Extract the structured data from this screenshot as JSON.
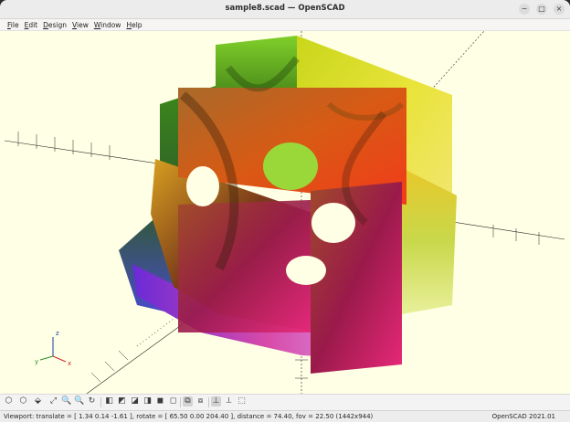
{
  "window": {
    "title": "sample8.scad — OpenSCAD"
  },
  "window_buttons": {
    "minimize": "−",
    "maximize": "□",
    "close": "×"
  },
  "menubar": [
    "File",
    "Edit",
    "Design",
    "View",
    "Window",
    "Help"
  ],
  "toolbar": {
    "icons": [
      "render-preview-icon",
      "render-icon",
      "export-stl-icon",
      "view-all-icon",
      "zoom-in-icon",
      "zoom-out-icon",
      "reset-view-icon",
      "view-right-icon",
      "view-top-icon",
      "view-bottom-icon",
      "view-left-icon",
      "view-front-icon",
      "view-back-icon",
      "perspective-icon",
      "orthogonal-icon",
      "show-axes-icon",
      "show-scale-markers-icon",
      "show-edges-icon"
    ],
    "glyphs": [
      "⬡",
      "⬡",
      "⬙",
      "⤢",
      "🔍",
      "🔍",
      "↻",
      "◧",
      "◩",
      "◪",
      "◨",
      "◼",
      "◻",
      "⧉",
      "⧈",
      "⊥",
      "⟂",
      "⬚"
    ]
  },
  "axis_indicator": {
    "x": "x",
    "y": "y",
    "z": "z"
  },
  "status": {
    "viewport": "Viewport: translate = [ 1.34 0.14 -1.61 ], rotate = [ 65.50 0.00 204.40 ], distance = 74.40, fov = 22.50 (1442x944)",
    "version": "OpenSCAD 2021.01"
  },
  "colors": {
    "viewport_bg": "#ffffe5",
    "axis_line": "#111111"
  }
}
